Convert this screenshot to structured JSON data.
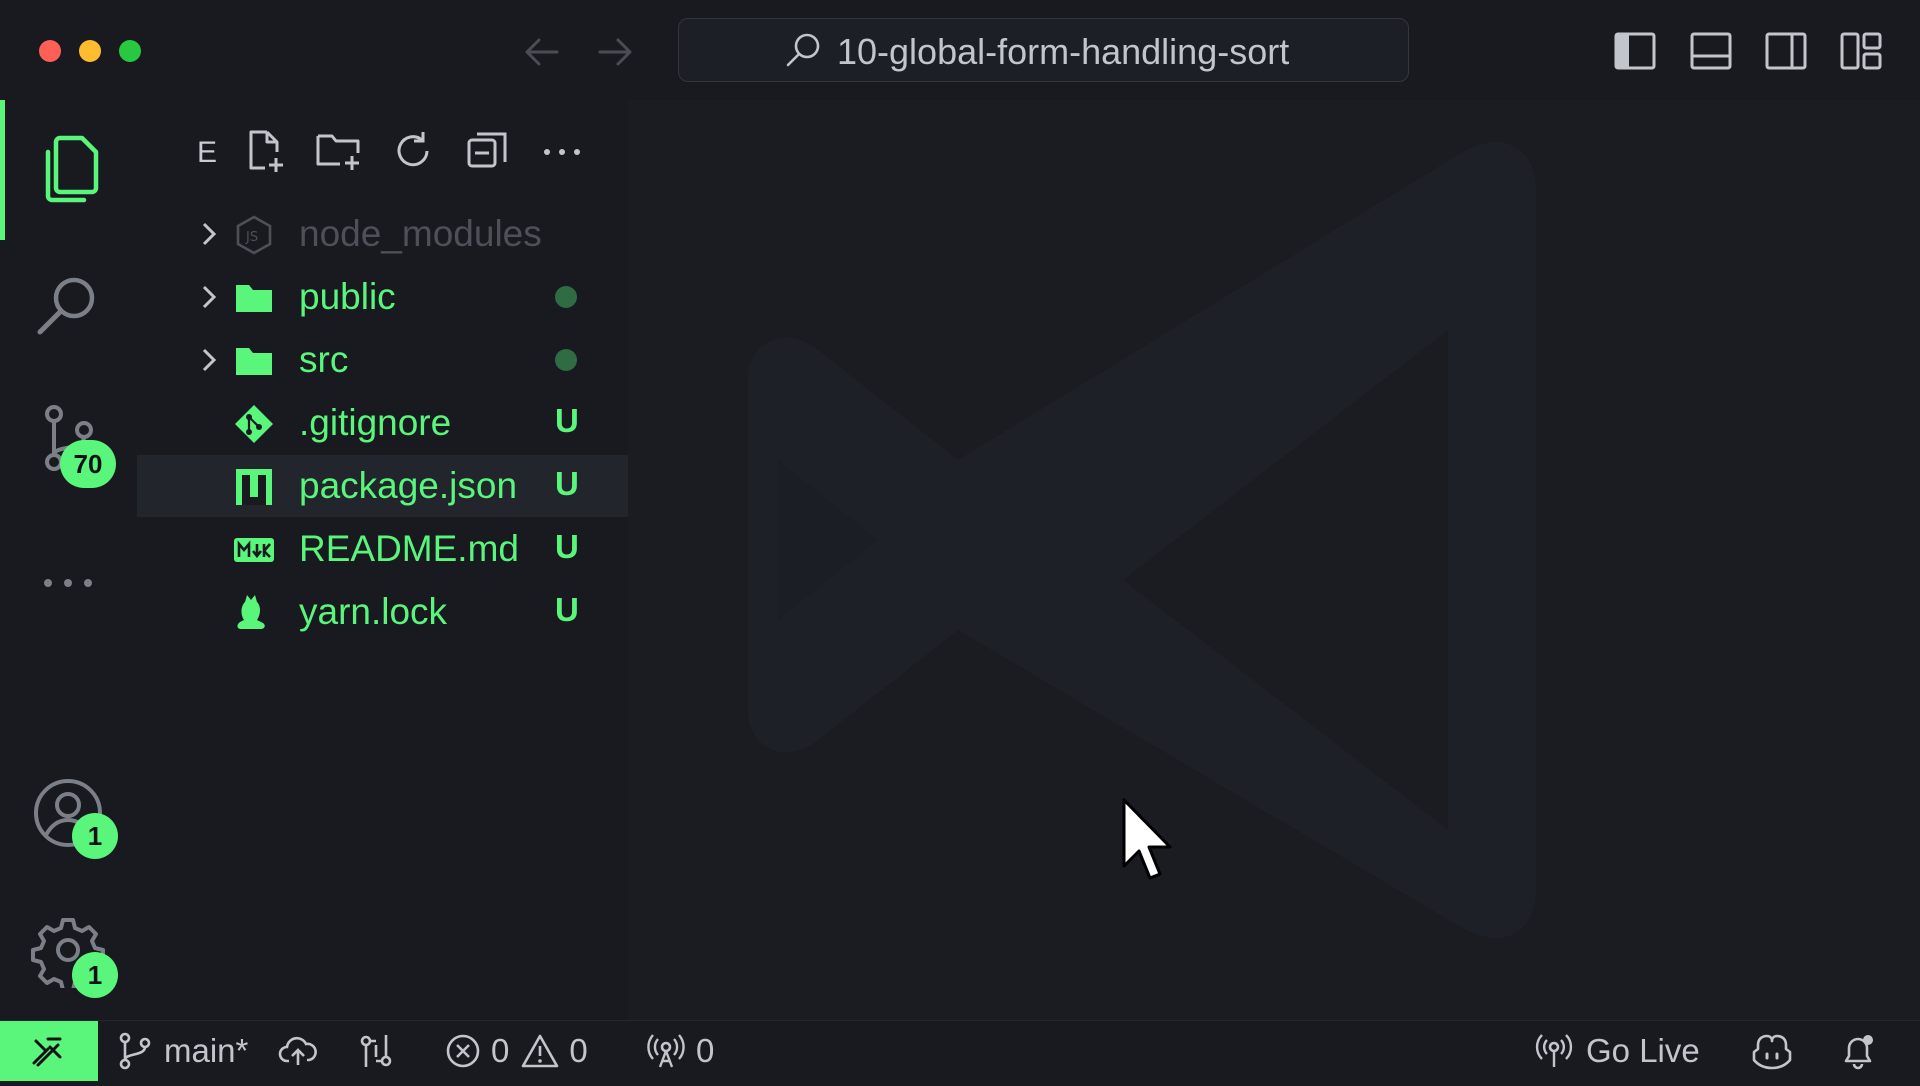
{
  "titlebar": {
    "search_text": "10-global-form-handling-sort",
    "icons": [
      "back-arrow-icon",
      "forward-arrow-icon",
      "search-icon",
      "toggle-primary-sidebar-icon",
      "toggle-panel-icon",
      "toggle-secondary-sidebar-icon",
      "customize-layout-icon"
    ]
  },
  "activity_bar": {
    "source_control_badge": "70",
    "accounts_badge": "1",
    "settings_badge": "1"
  },
  "explorer": {
    "title": "E",
    "items": [
      {
        "name": "node_modules",
        "status": "",
        "type": "folder-js",
        "ignored": true
      },
      {
        "name": "public",
        "status": "dot",
        "type": "folder"
      },
      {
        "name": "src",
        "status": "dot",
        "type": "folder"
      },
      {
        "name": ".gitignore",
        "status": "U",
        "type": "git"
      },
      {
        "name": "package.json",
        "status": "U",
        "type": "json",
        "selected": true
      },
      {
        "name": "README.md",
        "status": "U",
        "type": "markdown"
      },
      {
        "name": "yarn.lock",
        "status": "U",
        "type": "yarn"
      }
    ]
  },
  "statusbar": {
    "branch": "main*",
    "errors": "0",
    "warnings": "0",
    "ports": "0",
    "go_live": "Go Live"
  },
  "colors": {
    "accent": "#5af57b",
    "background": "#181a20",
    "editor_background": "#1a1c22"
  }
}
